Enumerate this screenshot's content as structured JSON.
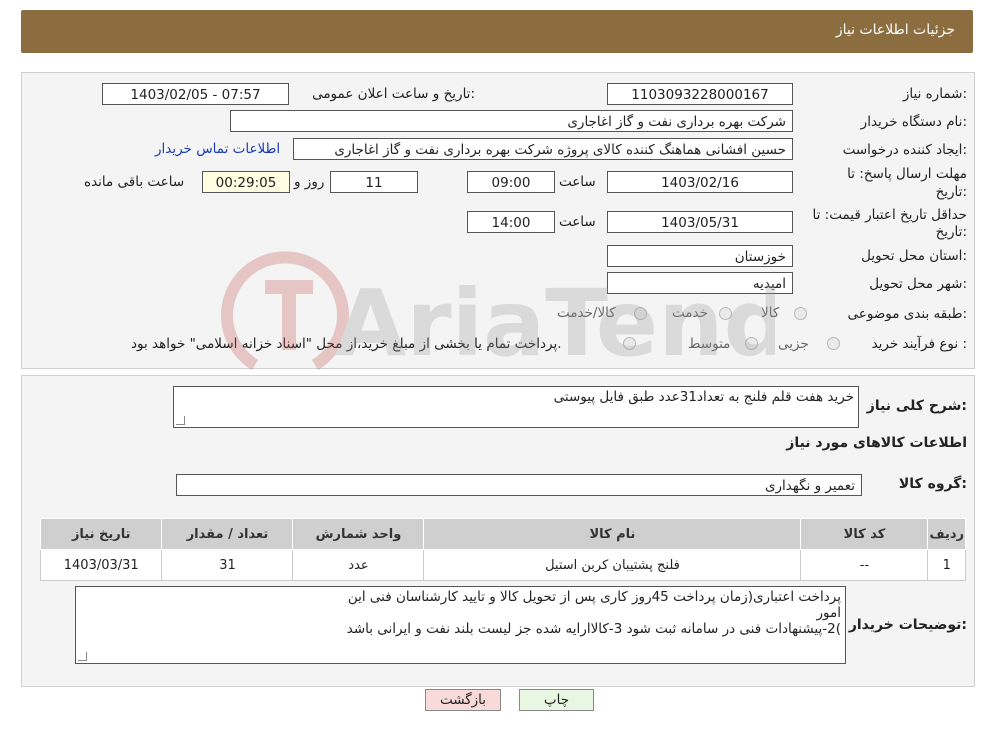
{
  "header": {
    "title": "جزئیات اطلاعات نیاز"
  },
  "form": {
    "need_number_label": "شماره نیاز:",
    "need_number": "1103093228000167",
    "announce_label": "تاریخ و ساعت اعلان عمومی:",
    "announce_value": "1403/02/05 - 07:57",
    "buyer_org_label": "نام دستگاه خریدار:",
    "buyer_org": "شرکت بهره برداری نفت و گاز اغاجاری",
    "creator_label": "ایجاد کننده درخواست:",
    "creator": "حسین افشانی هماهنگ کننده کالای پروژه شرکت بهره برداری نفت و گاز اغاجاری",
    "contact_link": "اطلاعات تماس خریدار",
    "deadline_label_1": "مهلت ارسال پاسخ: تا",
    "deadline_label_2": "تاریخ:",
    "deadline_date": "1403/02/16",
    "time_label": "ساعت",
    "deadline_time": "09:00",
    "days_value": "11",
    "days_label": "روز و",
    "remaining_time": "00:29:05",
    "remaining_label": "ساعت باقی مانده",
    "validity_label_1": "حداقل تاریخ اعتبار قیمت: تا",
    "validity_label_2": "تاریخ:",
    "validity_date": "1403/05/31",
    "validity_time": "14:00",
    "province_label": "استان محل تحویل:",
    "province": "خوزستان",
    "city_label": "شهر محل تحویل:",
    "city": "امیدیه",
    "category_label": "طبقه بندی موضوعی:",
    "category_options": [
      "کالا",
      "خدمت",
      "کالا/خدمت"
    ],
    "process_label": "نوع فرآیند خرید :",
    "process_options": [
      "جزیی",
      "متوسط"
    ],
    "process_note": "پرداخت تمام یا بخشی از مبلغ خرید،از محل \"اسناد خزانه اسلامی\" خواهد بود."
  },
  "description": {
    "label": "شرح کلی نیاز:",
    "text": "خرید هفت قلم فلنج به تعداد31عدد طبق فایل پیوستی"
  },
  "goods": {
    "section_title": "اطلاعات کالاهای مورد نیاز",
    "group_label": "گروه کالا:",
    "group_value": "تعمیر و نگهداری",
    "columns": [
      "ردیف",
      "کد کالا",
      "نام کالا",
      "واحد شمارش",
      "تعداد / مقدار",
      "تاریخ نیاز"
    ],
    "rows": [
      [
        "1",
        "--",
        "فلنج پشتیبان کربن استیل",
        "عدد",
        "31",
        "1403/03/31"
      ]
    ]
  },
  "buyer_notes": {
    "label": "توضیحات خریدار:",
    "lines": [
      "پرداخت اعتباری(زمان پرداخت 45روز کاری پس از تحویل کالا و تایید کارشناسان فنی این",
      "امور",
      ")2-پیشنهادات فنی در سامانه ثبت شود 3-کالاارایه شده جز لیست بلند نفت و ایرانی باشد"
    ]
  },
  "buttons": {
    "print": "چاپ",
    "back": "بازگشت"
  },
  "watermark": {
    "text": "AriaTender.neT"
  },
  "colors": {
    "header": "#8b6d40",
    "panel": "#f4f4f4",
    "link": "#1a3bb5",
    "back_button": "#f8dada"
  }
}
